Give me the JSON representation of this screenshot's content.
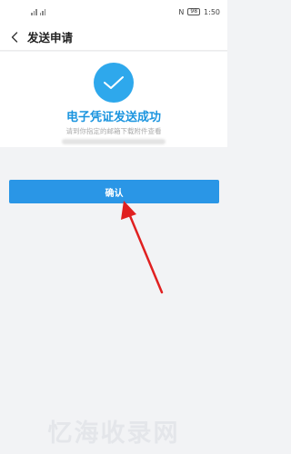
{
  "status_bar": {
    "left_indicators": "4G ull  4G ull",
    "nfc": "N",
    "battery": "98",
    "time": "1:50"
  },
  "header": {
    "title": "发送申请",
    "back_icon": "chevron-left-icon"
  },
  "result": {
    "icon": "checkmark-icon",
    "icon_color": "#2ea8ec",
    "title": "电子凭证发送成功",
    "subtitle": "请到你指定的邮箱下载附件查看",
    "title_color": "#1a94df"
  },
  "actions": {
    "confirm_label": "确认",
    "confirm_color": "#2a96e6"
  },
  "annotation": {
    "arrow_color": "#e02020"
  },
  "watermark": "忆海收录网"
}
